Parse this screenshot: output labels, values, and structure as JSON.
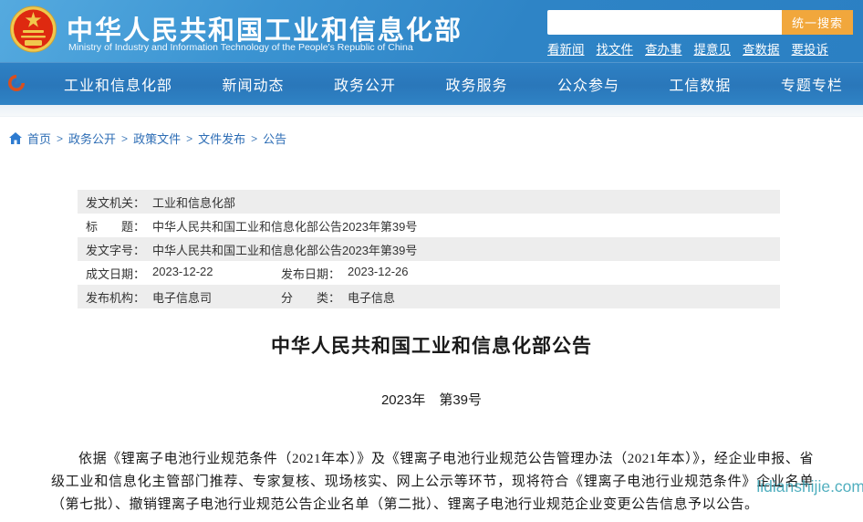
{
  "header": {
    "site_title": "中华人民共和国工业和信息化部",
    "site_subtitle": "Ministry of Industry and Information Technology of the People's Republic of China",
    "search": {
      "value": "",
      "button_label": "统一搜索"
    },
    "quick_links": [
      "看新闻",
      "找文件",
      "查办事",
      "提意见",
      "查数据",
      "要投诉"
    ]
  },
  "nav": {
    "items": [
      "工业和信息化部",
      "新闻动态",
      "政务公开",
      "政务服务",
      "公众参与",
      "工信数据",
      "专题专栏"
    ]
  },
  "breadcrumb": {
    "separator": ">",
    "items": [
      "首页",
      "政务公开",
      "政策文件",
      "文件发布",
      "公告"
    ]
  },
  "meta_table": {
    "rows": [
      {
        "label": "发文机关：",
        "value": "工业和信息化部"
      },
      {
        "label": "标　　题：",
        "value": "中华人民共和国工业和信息化部公告2023年第39号"
      },
      {
        "label": "发文字号：",
        "value": "中华人民共和国工业和信息化部公告2023年第39号"
      },
      {
        "label": "成文日期：",
        "value": "2023-12-22",
        "label2": "发布日期：",
        "value2": "2023-12-26"
      },
      {
        "label": "发布机构：",
        "value": "电子信息司",
        "label2": "分　　类：",
        "value2": "电子信息"
      }
    ]
  },
  "article": {
    "title": "中华人民共和国工业和信息化部公告",
    "issue_line": "2023年　第39号",
    "paragraph": "依据《锂离子电池行业规范条件（2021年本）》及《锂离子电池行业规范公告管理办法（2021年本）》，经企业申报、省级工业和信息化主管部门推荐、专家复核、现场核实、网上公示等环节，现将符合《锂离子电池行业规范条件》企业名单（第七批）、撤销锂离子电池行业规范公告企业名单（第二批）、锂离子电池行业规范企业变更公告信息予以公告。"
  },
  "watermark": "lidianshijie.com",
  "colors": {
    "header_blue": "#2e84c6",
    "nav_blue": "#2a77ba",
    "accent_orange": "#f1a73c",
    "link_blue": "#2d6db5",
    "row_gray": "#ededed",
    "watermark_teal": "#269bafcc",
    "emblem_red": "#de2910",
    "emblem_gold": "#f0c84c"
  }
}
